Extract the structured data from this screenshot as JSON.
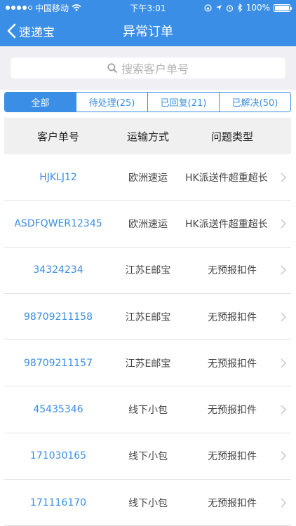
{
  "status_bar": {
    "carrier": "中国移动",
    "time": "下午3:01",
    "battery": "100%",
    "battery_level": 1.0
  },
  "nav": {
    "back_label": "速递宝",
    "title": "异常订单"
  },
  "search": {
    "placeholder": "搜索客户单号"
  },
  "tabs": [
    {
      "label": "全部",
      "active": true
    },
    {
      "label": "待处理(25)",
      "active": false
    },
    {
      "label": "已回复(21)",
      "active": false
    },
    {
      "label": "已解决(50)",
      "active": false
    }
  ],
  "table": {
    "headers": [
      "客户单号",
      "运输方式",
      "问题类型"
    ],
    "rows": [
      {
        "order": "HJKLJ12",
        "shipping": "欧洲速运",
        "issue": "HK派送件超重超长"
      },
      {
        "order": "ASDFQWER12345",
        "shipping": "欧洲速运",
        "issue": "HK派送件超重超长"
      },
      {
        "order": "34324234",
        "shipping": "江苏E邮宝",
        "issue": "无预报扣件"
      },
      {
        "order": "98709211158",
        "shipping": "江苏E邮宝",
        "issue": "无预报扣件"
      },
      {
        "order": "98709211157",
        "shipping": "江苏E邮宝",
        "issue": "无预报扣件"
      },
      {
        "order": "45435346",
        "shipping": "线下小包",
        "issue": "无预报扣件"
      },
      {
        "order": "171030165",
        "shipping": "线下小包",
        "issue": "无预报扣件"
      },
      {
        "order": "171116170",
        "shipping": "线下小包",
        "issue": "无预报扣件"
      }
    ]
  },
  "colors": {
    "accent": "#3a8ee6",
    "header_bg": "#f0f0f0",
    "search_bg": "#efeff4"
  },
  "icons": {
    "back": "chevron-left-icon",
    "search": "search-icon",
    "row_arrow": "chevron-right-icon",
    "wifi": "wifi-icon",
    "location": "location-icon",
    "alarm": "alarm-icon",
    "bluetooth": "bluetooth-icon",
    "lock": "rotation-lock-icon"
  }
}
